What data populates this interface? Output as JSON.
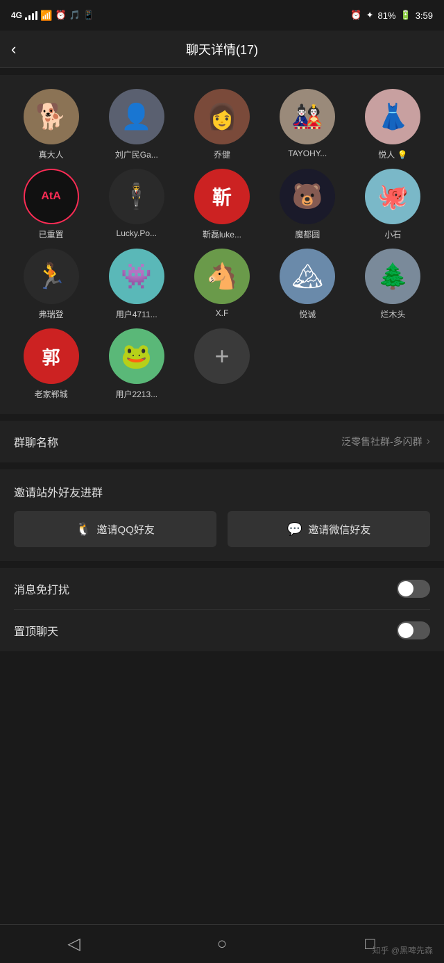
{
  "statusBar": {
    "network": "4G",
    "time": "3:59",
    "battery": "81%",
    "icons": [
      "alarm",
      "bluetooth",
      "battery"
    ]
  },
  "header": {
    "back": "‹",
    "title": "聊天详情(17)"
  },
  "members": [
    {
      "id": 1,
      "name": "真大人",
      "avatarType": "emoji",
      "avatarContent": "🐕",
      "bg": "#8B7355"
    },
    {
      "id": 2,
      "name": "刘广民Ga...",
      "avatarType": "gradient",
      "avatarContent": "👤",
      "bg": "#5a6070"
    },
    {
      "id": 3,
      "name": "乔健",
      "avatarType": "emoji",
      "avatarContent": "👩",
      "bg": "#7a4a3a"
    },
    {
      "id": 4,
      "name": "TAYOHY...",
      "avatarType": "emoji",
      "avatarContent": "🎎",
      "bg": "#9a8a7a"
    },
    {
      "id": 5,
      "name": "悦人 💡",
      "avatarType": "emoji",
      "avatarContent": "👗",
      "bg": "#c8a0a0"
    },
    {
      "id": 6,
      "name": "已重置",
      "avatarType": "text",
      "avatarContent": "AtA",
      "bg": "#222",
      "border": "#fe2c55"
    },
    {
      "id": 7,
      "name": "Lucky.Po...",
      "avatarType": "emoji",
      "avatarContent": "🕴",
      "bg": "#2a2a2a"
    },
    {
      "id": 8,
      "name": "靳磊luke...",
      "avatarType": "text",
      "avatarContent": "靳",
      "bg": "#cc2222"
    },
    {
      "id": 9,
      "name": "魔都圆",
      "avatarType": "emoji",
      "avatarContent": "🐻",
      "bg": "#1a1a2a"
    },
    {
      "id": 10,
      "name": "小石",
      "avatarType": "emoji",
      "avatarContent": "🐙",
      "bg": "#7ab8c8"
    },
    {
      "id": 11,
      "name": "弗瑞登",
      "avatarType": "emoji",
      "avatarContent": "🏃",
      "bg": "#2a2a2a"
    },
    {
      "id": 12,
      "name": "用户4711...",
      "avatarType": "emoji",
      "avatarContent": "👾",
      "bg": "#5ab8b8"
    },
    {
      "id": 13,
      "name": "X.F",
      "avatarType": "emoji",
      "avatarContent": "🐴",
      "bg": "#6a9a4a"
    },
    {
      "id": 14,
      "name": "悦诚",
      "avatarType": "emoji",
      "avatarContent": "🏔",
      "bg": "#6a8aaa"
    },
    {
      "id": 15,
      "name": "烂木头",
      "avatarType": "emoji",
      "avatarContent": "🌲",
      "bg": "#7a8a9a"
    },
    {
      "id": 16,
      "name": "老家郸城",
      "avatarType": "text",
      "avatarContent": "郭",
      "bg": "#cc2222"
    },
    {
      "id": 17,
      "name": "用户2213...",
      "avatarType": "emoji",
      "avatarContent": "🐸",
      "bg": "#5ab878"
    }
  ],
  "addButton": {
    "label": "+"
  },
  "groupName": {
    "label": "群聊名称",
    "value": "泛零售社群-多闪群"
  },
  "invite": {
    "title": "邀请站外好友进群",
    "qqButton": "邀请QQ好友",
    "wechatButton": "邀请微信好友"
  },
  "doNotDisturb": {
    "label": "消息免打扰",
    "enabled": false
  },
  "pinChat": {
    "label": "置顶聊天",
    "enabled": false
  },
  "bottomNav": {
    "back": "◁",
    "home": "○",
    "recent": "□"
  },
  "watermark": "知乎 @黑啤先森"
}
